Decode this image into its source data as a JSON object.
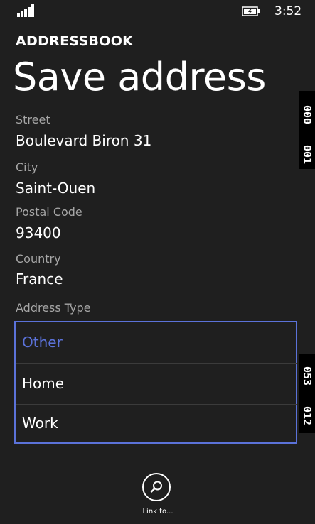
{
  "status_bar": {
    "time": "3:52",
    "signal_icon": "signal-strength-icon",
    "battery_icon": "battery-charging-icon"
  },
  "header": {
    "app_title": "ADDRESSBOOK",
    "page_title": "Save address"
  },
  "form": {
    "street_label": "Street",
    "street_value": "Boulevard Biron 31",
    "city_label": "City",
    "city_value": "Saint-Ouen",
    "postal_code_label": "Postal Code",
    "postal_code_value": "93400",
    "country_label": "Country",
    "country_value": "France",
    "address_type_label": "Address Type",
    "address_type_options": [
      "Other",
      "Home",
      "Work"
    ],
    "address_type_selected": "Other"
  },
  "edge_badges": {
    "top_a": "000",
    "top_b": "001",
    "bottom_a": "053",
    "bottom_b": "012"
  },
  "app_bar": {
    "link_label": "Link to...",
    "link_icon": "search-icon"
  },
  "colors": {
    "background": "#1f1f1f",
    "accent": "#5b72d9",
    "label": "#a6a6a6",
    "text": "#ffffff"
  }
}
